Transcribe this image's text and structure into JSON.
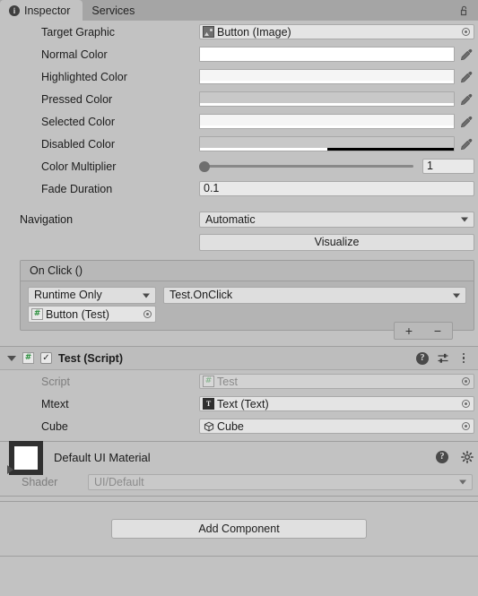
{
  "window": {
    "tabs": [
      {
        "label": "Inspector",
        "icon": "info-icon",
        "active": true
      },
      {
        "label": "Services",
        "icon": null,
        "active": false
      }
    ],
    "lock_icon": "padlock-open-icon"
  },
  "button_component": {
    "target_graphic": {
      "label": "Target Graphic",
      "value": "Button (Image)",
      "icon": "image-icon"
    },
    "colors": [
      {
        "label": "Normal Color",
        "hex": "#FFFFFF",
        "alpha": 1.0
      },
      {
        "label": "Highlighted Color",
        "hex": "#F5F5F5",
        "alpha": 1.0
      },
      {
        "label": "Pressed Color",
        "hex": "#C8C8C8",
        "alpha": 1.0
      },
      {
        "label": "Selected Color",
        "hex": "#F5F5F5",
        "alpha": 1.0
      },
      {
        "label": "Disabled Color",
        "hex": "#C8C8C8",
        "alpha": 0.5
      }
    ],
    "color_multiplier": {
      "label": "Color Multiplier",
      "value": "1",
      "slider_pos_pct": 0
    },
    "fade_duration": {
      "label": "Fade Duration",
      "value": "0.1"
    },
    "navigation": {
      "label": "Navigation",
      "value": "Automatic"
    },
    "visualize_button": "Visualize",
    "on_click": {
      "title": "On Click ()",
      "entries": [
        {
          "mode": "Runtime Only",
          "function": "Test.OnClick",
          "object": "Button (Test)",
          "object_icon": "csharp-script-icon"
        }
      ],
      "add_label": "+",
      "remove_label": "−"
    }
  },
  "test_script": {
    "title": "Test (Script)",
    "enabled": true,
    "icon": "csharp-script-icon",
    "header_icons": [
      "help-icon",
      "preset-icon",
      "kebab-menu-icon"
    ],
    "fields": [
      {
        "label": "Script",
        "value": "Test",
        "icon": "csharp-script-icon",
        "disabled": true
      },
      {
        "label": "Mtext",
        "value": "Text (Text)",
        "icon": "text-icon",
        "disabled": false
      },
      {
        "label": "Cube",
        "value": "Cube",
        "icon": "cube-icon",
        "disabled": false
      }
    ]
  },
  "material": {
    "name": "Default UI Material",
    "preview_color": "#FFFFFF",
    "shader_label": "Shader",
    "shader_value": "UI/Default",
    "header_icons": [
      "help-icon",
      "gear-icon"
    ]
  },
  "footer": {
    "add_component": "Add Component"
  }
}
